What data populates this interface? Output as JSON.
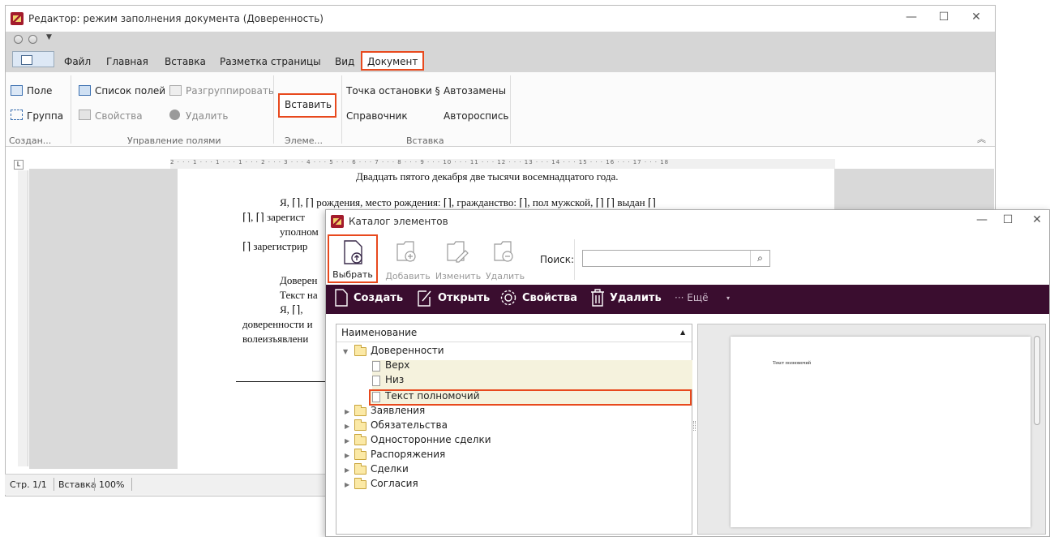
{
  "editor": {
    "title": "Редактор: режим заполнения документа (Доверенность)",
    "window_controls": {
      "minimize": "—",
      "maximize": "☐",
      "close": "✕"
    },
    "tabs": [
      "Файл",
      "Главная",
      "Вставка",
      "Разметка страницы",
      "Вид",
      "Документ"
    ],
    "ribbon": {
      "field": "Поле",
      "group": "Группа",
      "fields_list": "Список полей",
      "ungroup": "Разгруппировать",
      "properties": "Свойства",
      "delete": "Удалить",
      "insert": "Вставить",
      "breakpoint": "Точка остановки §",
      "autoreplace": "Автозамены",
      "reference": "Справочник",
      "autosign": "Автороспись",
      "group_labels": [
        "Создан...",
        "Управление полями",
        "Элеме...",
        "Вставка"
      ]
    },
    "ruler_text": "2 · · · 1 · · · 1 · · · 1 · · · 2 · · · 3 · · · 4 · · · 5 · · · 6 · · · 7 · · · 8 · · · 9 · · · 10 · · · 11 · · · 12 · · · 13 · · · 14 · · · 15 · · · 16 · · · 17 · · · 18",
    "document_lines": [
      "Двадцать пятого декабря две тысячи восемнадцатого года.",
      "Я, ⌈⌉, ⌈⌉ рождения, место рождения: ⌈⌉, гражданство: ⌈⌉, пол мужской, ⌈⌉ ⌈⌉ выдан ⌈⌉",
      "⌈⌉, ⌈⌉ зарегист",
      "уполном",
      "⌈⌉ зарегистрир",
      "Доверен",
      "Текст на",
      "Я,    ⌈⌉,",
      "доверенности и",
      "волеизъявлени"
    ],
    "status": {
      "page": "Стр. 1/1",
      "mode": "Вставка",
      "zoom": "100%"
    }
  },
  "catalog": {
    "title": "Каталог элементов",
    "window_controls": {
      "minimize": "—",
      "maximize": "☐",
      "close": "✕"
    },
    "toolbar": {
      "select": "Выбрать",
      "add": "Добавить",
      "edit": "Изменить",
      "delete": "Удалить",
      "search_label": "Поиск:",
      "search_value": ""
    },
    "actions": {
      "create": "Создать",
      "open": "Открыть",
      "properties": "Свойства",
      "delete": "Удалить",
      "more": "··· Ещё"
    },
    "tree": {
      "header": "Наименование",
      "items": [
        {
          "label": "Доверенности",
          "level": 0,
          "type": "folder",
          "expanded": true
        },
        {
          "label": "Верх",
          "level": 1,
          "type": "doc"
        },
        {
          "label": "Низ",
          "level": 1,
          "type": "doc"
        },
        {
          "label": "Текст полномочий",
          "level": 1,
          "type": "doc",
          "selected": true
        },
        {
          "label": "Заявления",
          "level": 0,
          "type": "folder"
        },
        {
          "label": "Обязательства",
          "level": 0,
          "type": "folder"
        },
        {
          "label": "Односторонние сделки",
          "level": 0,
          "type": "folder"
        },
        {
          "label": "Распоряжения",
          "level": 0,
          "type": "folder"
        },
        {
          "label": "Сделки",
          "level": 0,
          "type": "folder"
        },
        {
          "label": "Согласия",
          "level": 0,
          "type": "folder"
        }
      ]
    },
    "preview_text": "Текст полномочий"
  },
  "colors": {
    "accent": "#e8491d",
    "action_bar": "#3a0d2f",
    "brand": "#a31b2c"
  }
}
